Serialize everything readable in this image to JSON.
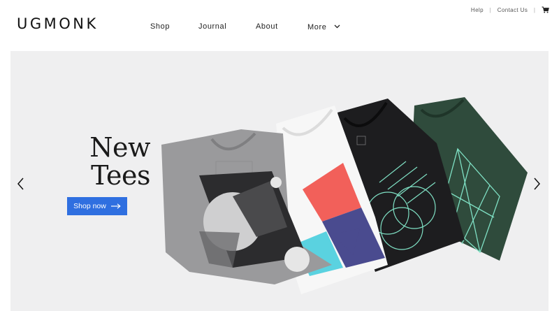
{
  "brand": {
    "logo_text": "UGMONK"
  },
  "nav": {
    "items": [
      {
        "label": "Shop"
      },
      {
        "label": "Journal"
      },
      {
        "label": "About"
      },
      {
        "label": "More"
      }
    ]
  },
  "utility": {
    "help": "Help",
    "contact": "Contact Us",
    "cart_icon": "cart-icon"
  },
  "hero": {
    "title_line1": "New",
    "title_line2": "Tees",
    "cta_label": "Shop now",
    "prev_icon": "chevron-left-icon",
    "next_icon": "chevron-right-icon",
    "colors": {
      "background": "#efeff0",
      "cta": "#2f6fe0",
      "shirt_gray": "#9a9a9c",
      "shirt_white": "#f7f7f7",
      "shirt_black": "#1d1d1f",
      "shirt_green": "#2f4b3c",
      "accent_mint": "#7fe0c4",
      "accent_coral": "#f2605a",
      "accent_purple": "#4a4b8f",
      "accent_cyan": "#5ad2e0"
    }
  }
}
